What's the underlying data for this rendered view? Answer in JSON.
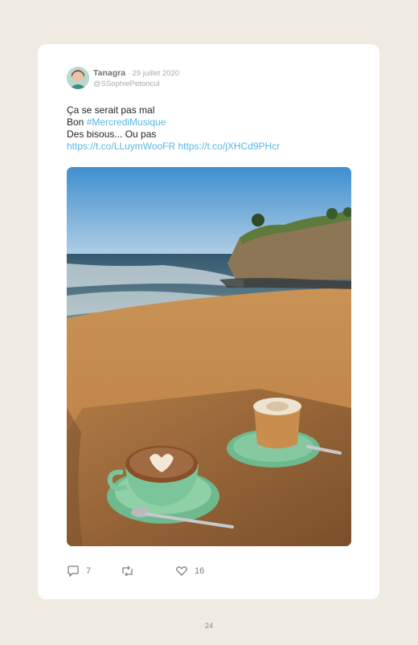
{
  "tweet": {
    "author_name": "Tanagra",
    "date": " · 29 juillet 2020",
    "handle": "@SSophiePetoncul",
    "lines": [
      {
        "before": "Ça se serait pas mal",
        "link": ""
      },
      {
        "before": "Bon ",
        "link": "#MercrediMusique"
      },
      {
        "before": "Des bisous... Ou pas",
        "link": ""
      },
      {
        "before": "",
        "link": "https://t.co/LLuymWooFR https://t.co/jXHCd9PHcr"
      }
    ],
    "photo": {
      "scene": "beach-coffee-photo"
    },
    "actions": {
      "reply_count": "7",
      "retweet_count": "",
      "like_count": "16"
    }
  },
  "page": {
    "number": "24"
  },
  "colors": {
    "link": "#58b7e3",
    "background": "#efebe2",
    "card": "#ffffff"
  }
}
